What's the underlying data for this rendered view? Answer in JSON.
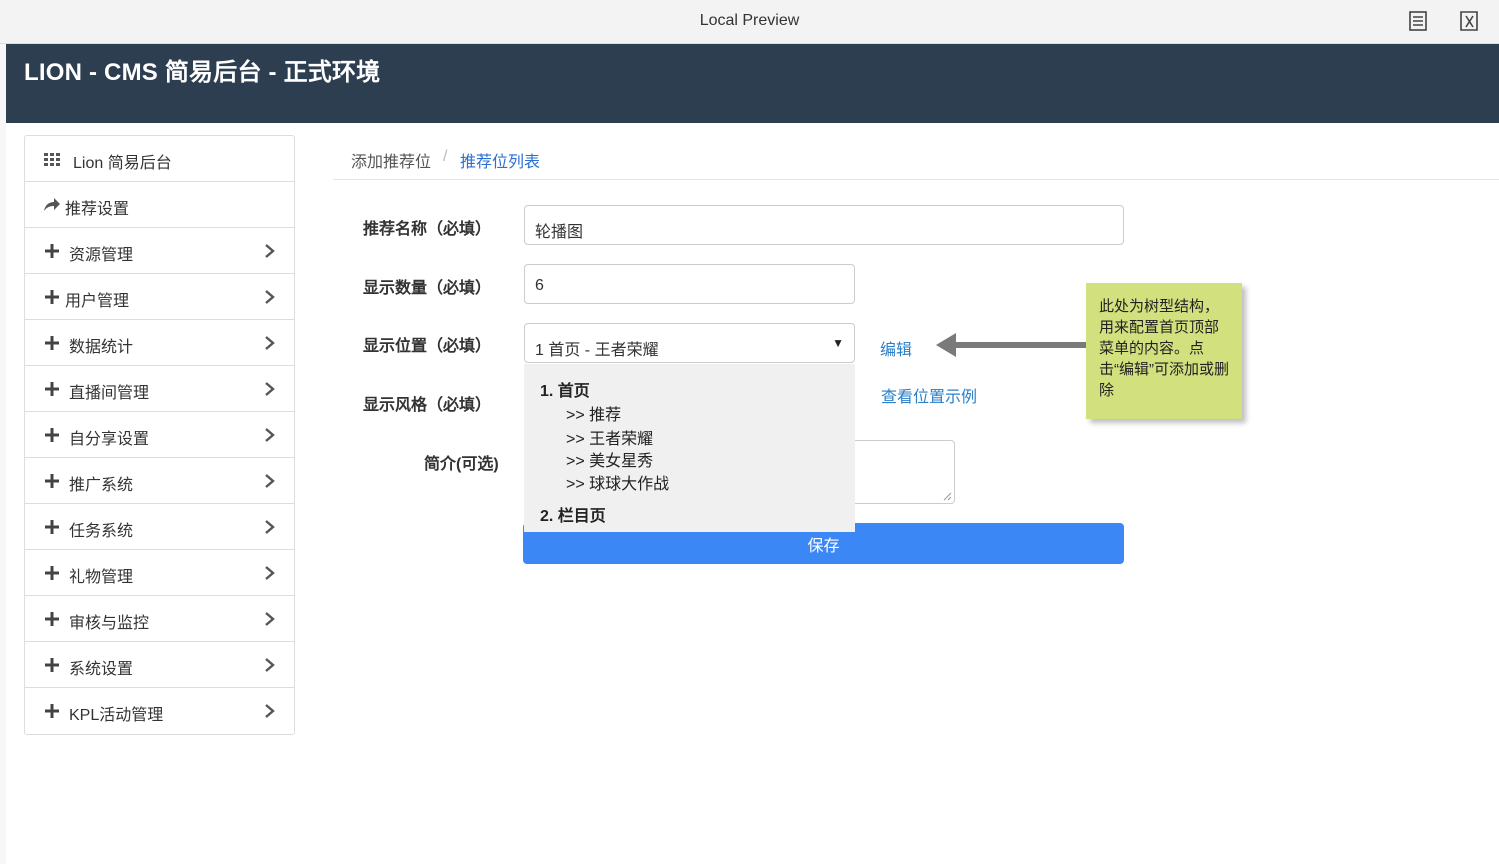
{
  "window": {
    "title": "Local Preview"
  },
  "header": {
    "brand": "LION - CMS 简易后台 - 正式环境"
  },
  "sidebar": {
    "items": [
      {
        "label": "Lion 简易后台",
        "icon": "grid-icon"
      },
      {
        "label": "推荐设置",
        "icon": "share-icon"
      },
      {
        "label": "资源管理",
        "icon": "plus-icon"
      },
      {
        "label": "用户管理",
        "icon": "plus-icon"
      },
      {
        "label": "数据统计",
        "icon": "plus-icon"
      },
      {
        "label": "直播间管理",
        "icon": "plus-icon"
      },
      {
        "label": "自分享设置",
        "icon": "plus-icon"
      },
      {
        "label": "推广系统",
        "icon": "plus-icon"
      },
      {
        "label": "任务系统",
        "icon": "plus-icon"
      },
      {
        "label": "礼物管理",
        "icon": "plus-icon"
      },
      {
        "label": "审核与监控",
        "icon": "plus-icon"
      },
      {
        "label": "系统设置",
        "icon": "plus-icon"
      },
      {
        "label": "KPL活动管理",
        "icon": "plus-icon"
      }
    ]
  },
  "breadcrumb": {
    "first": "添加推荐位",
    "separator": "/",
    "second": "推荐位列表"
  },
  "form": {
    "name_label": "推荐名称（必填）",
    "name_value": "轮播图",
    "count_label": "显示数量（必填）",
    "count_value": "6",
    "position_label": "显示位置（必填）",
    "position_value": "1 首页 - 王者荣耀",
    "edit_link": "编辑",
    "style_label": "显示风格（必填）",
    "style_example_link": "查看位置示例",
    "intro_label": "简介(可选)",
    "save_label": "保存"
  },
  "dropdown": {
    "groups": [
      {
        "label": "1. 首页",
        "options": [
          ">> 推荐",
          ">> 王者荣耀",
          ">> 美女星秀",
          ">> 球球大作战"
        ]
      },
      {
        "label": "2. 栏目页",
        "options": []
      }
    ]
  },
  "annotation": {
    "text": "此处为树型结构，用来配置首页顶部菜单的内容。点击“编辑”可添加或删除"
  },
  "colors": {
    "header_bg": "#2c3e50",
    "primary_button": "#3b87f5",
    "link": "#2a7fc9",
    "note_bg": "#d2e07d"
  }
}
